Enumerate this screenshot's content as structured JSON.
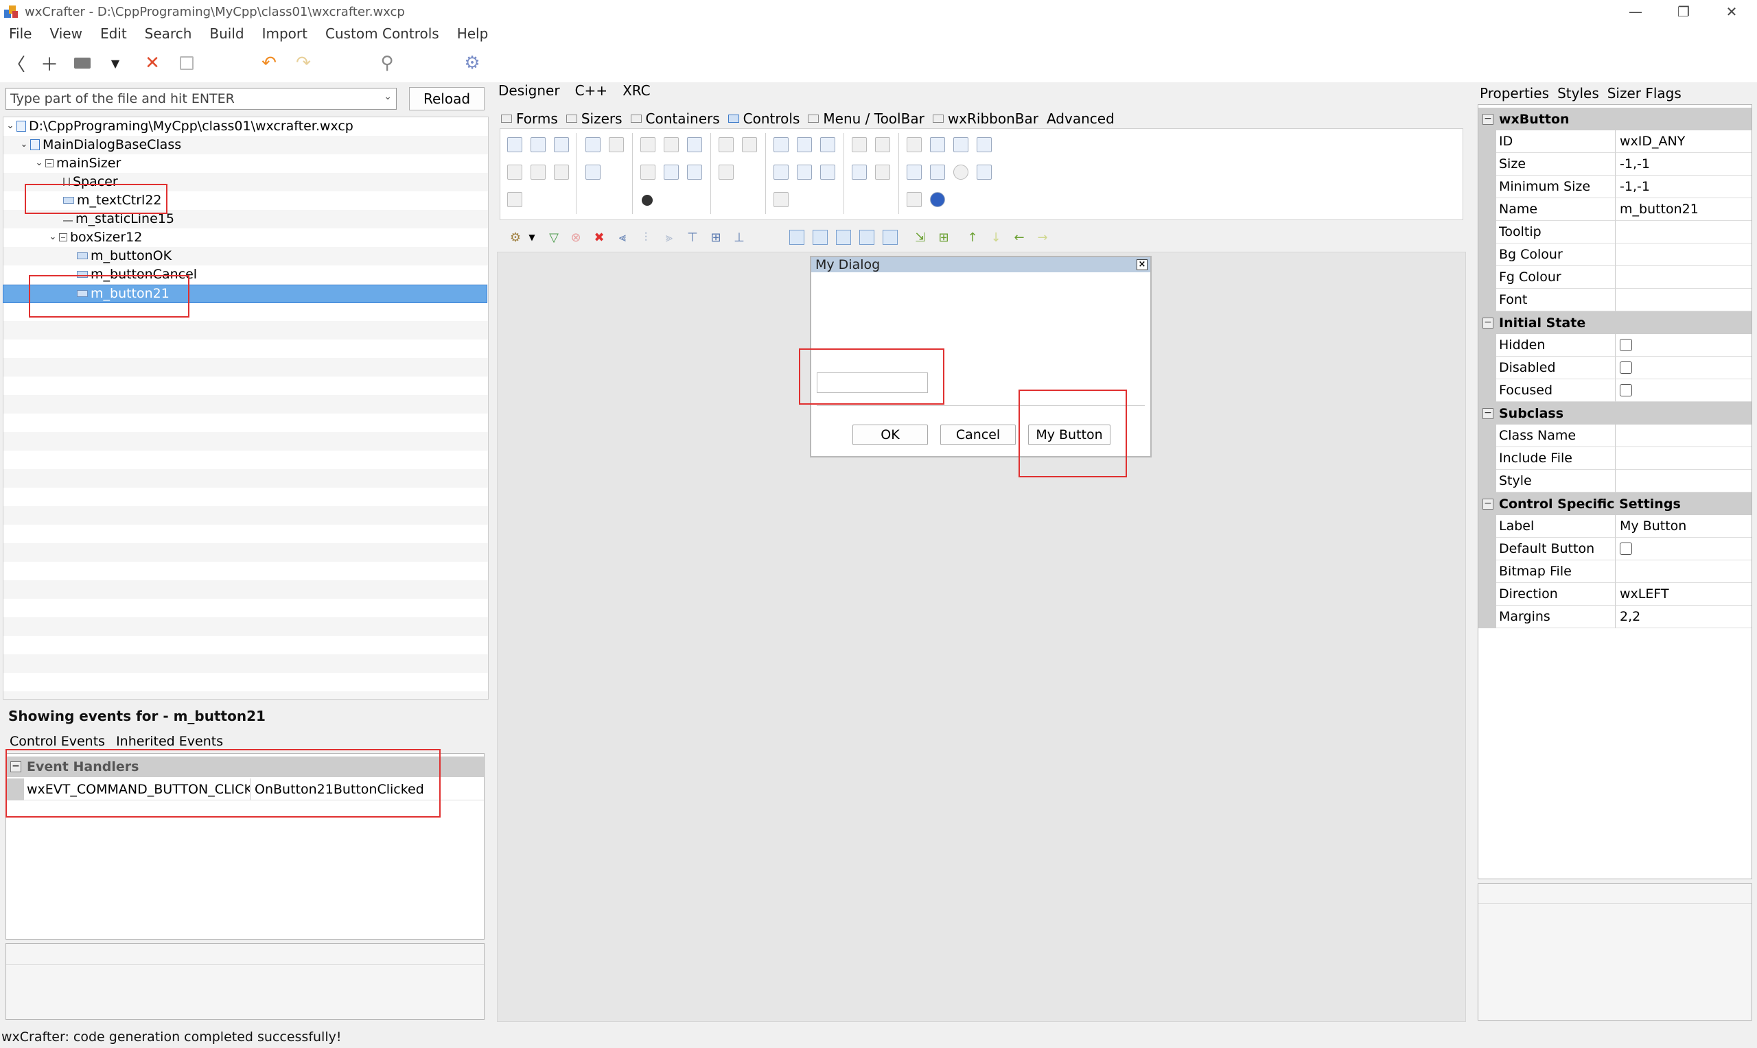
{
  "window": {
    "title": "wxCrafter - D:\\CppPrograming\\MyCpp\\class01\\wxcrafter.wxcp",
    "controls": {
      "minimize": "—",
      "restore": "❐",
      "close": "✕"
    }
  },
  "menu": [
    "File",
    "View",
    "Edit",
    "Search",
    "Build",
    "Import",
    "Custom Controls",
    "Help"
  ],
  "toolbar": {
    "icons": [
      "back-icon",
      "add-icon",
      "open-folder-icon",
      "dropdown-arrow-icon",
      "close-x-icon",
      "save-icon",
      "undo-icon",
      "redo-icon",
      "search-icon",
      "settings-gear-icon"
    ],
    "glyphs": {
      "back": "〈",
      "add": "＋",
      "dropdown": "▼",
      "close": "✕",
      "undo": "↶",
      "redo": "↷",
      "search": "⚲",
      "gear": "⚙"
    }
  },
  "left": {
    "search_placeholder": "Type part of the file and hit ENTER",
    "reload_label": "Reload",
    "tree": [
      {
        "label": "D:\\CppPrograming\\MyCpp\\class01\\wxcrafter.wxcp",
        "toggle": "⌄",
        "icon": "file"
      },
      {
        "label": "MainDialogBaseClass",
        "toggle": "⌄",
        "icon": "file"
      },
      {
        "label": "mainSizer",
        "toggle": "⌄",
        "icon": "sizer"
      },
      {
        "label": "Spacer",
        "toggle": "",
        "icon": "spacer"
      },
      {
        "label": "m_textCtrl22",
        "toggle": "",
        "icon": "ctl"
      },
      {
        "label": "m_staticLine15",
        "toggle": "",
        "icon": "line"
      },
      {
        "label": "boxSizer12",
        "toggle": "⌄",
        "icon": "sizer"
      },
      {
        "label": "m_buttonOK",
        "toggle": "",
        "icon": "ctl"
      },
      {
        "label": "m_buttonCancel",
        "toggle": "",
        "icon": "ctl"
      },
      {
        "label": "m_button21",
        "toggle": "",
        "icon": "ctl"
      }
    ],
    "events_title": "Showing events for - m_button21",
    "event_tabs": [
      "Control Events",
      "Inherited Events"
    ],
    "event_category": "Event Handlers",
    "event_collapse": "−",
    "event_rows": [
      {
        "event": "wxEVT_COMMAND_BUTTON_CLICKED",
        "handler": "OnButton21ButtonClicked"
      }
    ]
  },
  "designer": {
    "tabs": [
      "Designer",
      "C++",
      "XRC"
    ],
    "palette_tabs": [
      "Forms",
      "Sizers",
      "Containers",
      "Controls",
      "Menu / ToolBar",
      "wxRibbonBar",
      "Advanced"
    ],
    "active_palette_tab": "Controls",
    "dialog": {
      "title": "My Dialog",
      "close": "×",
      "buttons": [
        "OK",
        "Cancel",
        "My Button"
      ]
    }
  },
  "properties": {
    "tabs": [
      "Properties",
      "Styles",
      "Sizer Flags"
    ],
    "collapse": "−",
    "sections": [
      {
        "title": "wxButton",
        "rows": [
          {
            "key": "ID",
            "value": "wxID_ANY"
          },
          {
            "key": "Size",
            "value": "-1,-1"
          },
          {
            "key": "Minimum Size",
            "value": "-1,-1"
          },
          {
            "key": "Name",
            "value": "m_button21"
          },
          {
            "key": "Tooltip",
            "value": ""
          },
          {
            "key": "Bg Colour",
            "value": ""
          },
          {
            "key": "Fg Colour",
            "value": ""
          },
          {
            "key": "Font",
            "value": ""
          }
        ]
      },
      {
        "title": "Initial State",
        "rows": [
          {
            "key": "Hidden",
            "value": "",
            "checkbox": true
          },
          {
            "key": "Disabled",
            "value": "",
            "checkbox": true
          },
          {
            "key": "Focused",
            "value": "",
            "checkbox": true
          }
        ]
      },
      {
        "title": "Subclass",
        "rows": [
          {
            "key": "Class Name",
            "value": ""
          },
          {
            "key": "Include File",
            "value": ""
          },
          {
            "key": "Style",
            "value": ""
          }
        ]
      },
      {
        "title": "Control Specific Settings",
        "rows": [
          {
            "key": "Label",
            "value": "My Button"
          },
          {
            "key": "Default Button",
            "value": "",
            "checkbox": true
          },
          {
            "key": "Bitmap File",
            "value": ""
          },
          {
            "key": "Direction",
            "value": "wxLEFT"
          },
          {
            "key": "Margins",
            "value": "2,2"
          }
        ]
      }
    ]
  },
  "status": "wxCrafter: code generation completed successfully!",
  "colors": {
    "selection": "#6aaae8",
    "highlight_box": "#e03030",
    "category_bg": "#cdcdcd"
  }
}
